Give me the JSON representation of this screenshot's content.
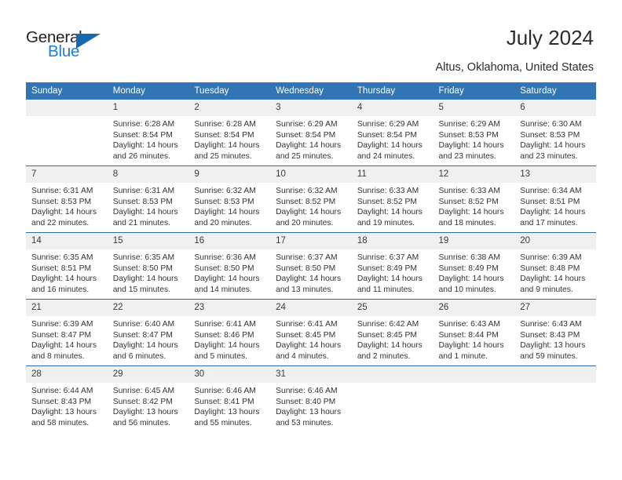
{
  "brand": {
    "name_top": "General",
    "name_bottom": "Blue",
    "colors": {
      "top_text": "#231f20",
      "bottom_text": "#1c7fd4",
      "triangle": "#1769b0"
    }
  },
  "header": {
    "title": "July 2024",
    "subtitle": "Altus, Oklahoma, United States"
  },
  "theme": {
    "header_bg": "#3275b5",
    "header_text": "#ffffff",
    "row_border": "#2e6da4",
    "daynum_bg": "#f0f0f0",
    "cell_bg": "#ffffff",
    "body_text": "#333333"
  },
  "calendar": {
    "weekdays": [
      "Sunday",
      "Monday",
      "Tuesday",
      "Wednesday",
      "Thursday",
      "Friday",
      "Saturday"
    ],
    "weeks": [
      [
        {
          "day": "",
          "sunrise": "",
          "sunset": "",
          "daylight1": "",
          "daylight2": ""
        },
        {
          "day": "1",
          "sunrise": "Sunrise: 6:28 AM",
          "sunset": "Sunset: 8:54 PM",
          "daylight1": "Daylight: 14 hours",
          "daylight2": "and 26 minutes."
        },
        {
          "day": "2",
          "sunrise": "Sunrise: 6:28 AM",
          "sunset": "Sunset: 8:54 PM",
          "daylight1": "Daylight: 14 hours",
          "daylight2": "and 25 minutes."
        },
        {
          "day": "3",
          "sunrise": "Sunrise: 6:29 AM",
          "sunset": "Sunset: 8:54 PM",
          "daylight1": "Daylight: 14 hours",
          "daylight2": "and 25 minutes."
        },
        {
          "day": "4",
          "sunrise": "Sunrise: 6:29 AM",
          "sunset": "Sunset: 8:54 PM",
          "daylight1": "Daylight: 14 hours",
          "daylight2": "and 24 minutes."
        },
        {
          "day": "5",
          "sunrise": "Sunrise: 6:29 AM",
          "sunset": "Sunset: 8:53 PM",
          "daylight1": "Daylight: 14 hours",
          "daylight2": "and 23 minutes."
        },
        {
          "day": "6",
          "sunrise": "Sunrise: 6:30 AM",
          "sunset": "Sunset: 8:53 PM",
          "daylight1": "Daylight: 14 hours",
          "daylight2": "and 23 minutes."
        }
      ],
      [
        {
          "day": "7",
          "sunrise": "Sunrise: 6:31 AM",
          "sunset": "Sunset: 8:53 PM",
          "daylight1": "Daylight: 14 hours",
          "daylight2": "and 22 minutes."
        },
        {
          "day": "8",
          "sunrise": "Sunrise: 6:31 AM",
          "sunset": "Sunset: 8:53 PM",
          "daylight1": "Daylight: 14 hours",
          "daylight2": "and 21 minutes."
        },
        {
          "day": "9",
          "sunrise": "Sunrise: 6:32 AM",
          "sunset": "Sunset: 8:53 PM",
          "daylight1": "Daylight: 14 hours",
          "daylight2": "and 20 minutes."
        },
        {
          "day": "10",
          "sunrise": "Sunrise: 6:32 AM",
          "sunset": "Sunset: 8:52 PM",
          "daylight1": "Daylight: 14 hours",
          "daylight2": "and 20 minutes."
        },
        {
          "day": "11",
          "sunrise": "Sunrise: 6:33 AM",
          "sunset": "Sunset: 8:52 PM",
          "daylight1": "Daylight: 14 hours",
          "daylight2": "and 19 minutes."
        },
        {
          "day": "12",
          "sunrise": "Sunrise: 6:33 AM",
          "sunset": "Sunset: 8:52 PM",
          "daylight1": "Daylight: 14 hours",
          "daylight2": "and 18 minutes."
        },
        {
          "day": "13",
          "sunrise": "Sunrise: 6:34 AM",
          "sunset": "Sunset: 8:51 PM",
          "daylight1": "Daylight: 14 hours",
          "daylight2": "and 17 minutes."
        }
      ],
      [
        {
          "day": "14",
          "sunrise": "Sunrise: 6:35 AM",
          "sunset": "Sunset: 8:51 PM",
          "daylight1": "Daylight: 14 hours",
          "daylight2": "and 16 minutes."
        },
        {
          "day": "15",
          "sunrise": "Sunrise: 6:35 AM",
          "sunset": "Sunset: 8:50 PM",
          "daylight1": "Daylight: 14 hours",
          "daylight2": "and 15 minutes."
        },
        {
          "day": "16",
          "sunrise": "Sunrise: 6:36 AM",
          "sunset": "Sunset: 8:50 PM",
          "daylight1": "Daylight: 14 hours",
          "daylight2": "and 14 minutes."
        },
        {
          "day": "17",
          "sunrise": "Sunrise: 6:37 AM",
          "sunset": "Sunset: 8:50 PM",
          "daylight1": "Daylight: 14 hours",
          "daylight2": "and 13 minutes."
        },
        {
          "day": "18",
          "sunrise": "Sunrise: 6:37 AM",
          "sunset": "Sunset: 8:49 PM",
          "daylight1": "Daylight: 14 hours",
          "daylight2": "and 11 minutes."
        },
        {
          "day": "19",
          "sunrise": "Sunrise: 6:38 AM",
          "sunset": "Sunset: 8:49 PM",
          "daylight1": "Daylight: 14 hours",
          "daylight2": "and 10 minutes."
        },
        {
          "day": "20",
          "sunrise": "Sunrise: 6:39 AM",
          "sunset": "Sunset: 8:48 PM",
          "daylight1": "Daylight: 14 hours",
          "daylight2": "and 9 minutes."
        }
      ],
      [
        {
          "day": "21",
          "sunrise": "Sunrise: 6:39 AM",
          "sunset": "Sunset: 8:47 PM",
          "daylight1": "Daylight: 14 hours",
          "daylight2": "and 8 minutes."
        },
        {
          "day": "22",
          "sunrise": "Sunrise: 6:40 AM",
          "sunset": "Sunset: 8:47 PM",
          "daylight1": "Daylight: 14 hours",
          "daylight2": "and 6 minutes."
        },
        {
          "day": "23",
          "sunrise": "Sunrise: 6:41 AM",
          "sunset": "Sunset: 8:46 PM",
          "daylight1": "Daylight: 14 hours",
          "daylight2": "and 5 minutes."
        },
        {
          "day": "24",
          "sunrise": "Sunrise: 6:41 AM",
          "sunset": "Sunset: 8:45 PM",
          "daylight1": "Daylight: 14 hours",
          "daylight2": "and 4 minutes."
        },
        {
          "day": "25",
          "sunrise": "Sunrise: 6:42 AM",
          "sunset": "Sunset: 8:45 PM",
          "daylight1": "Daylight: 14 hours",
          "daylight2": "and 2 minutes."
        },
        {
          "day": "26",
          "sunrise": "Sunrise: 6:43 AM",
          "sunset": "Sunset: 8:44 PM",
          "daylight1": "Daylight: 14 hours",
          "daylight2": "and 1 minute."
        },
        {
          "day": "27",
          "sunrise": "Sunrise: 6:43 AM",
          "sunset": "Sunset: 8:43 PM",
          "daylight1": "Daylight: 13 hours",
          "daylight2": "and 59 minutes."
        }
      ],
      [
        {
          "day": "28",
          "sunrise": "Sunrise: 6:44 AM",
          "sunset": "Sunset: 8:43 PM",
          "daylight1": "Daylight: 13 hours",
          "daylight2": "and 58 minutes."
        },
        {
          "day": "29",
          "sunrise": "Sunrise: 6:45 AM",
          "sunset": "Sunset: 8:42 PM",
          "daylight1": "Daylight: 13 hours",
          "daylight2": "and 56 minutes."
        },
        {
          "day": "30",
          "sunrise": "Sunrise: 6:46 AM",
          "sunset": "Sunset: 8:41 PM",
          "daylight1": "Daylight: 13 hours",
          "daylight2": "and 55 minutes."
        },
        {
          "day": "31",
          "sunrise": "Sunrise: 6:46 AM",
          "sunset": "Sunset: 8:40 PM",
          "daylight1": "Daylight: 13 hours",
          "daylight2": "and 53 minutes."
        },
        {
          "day": "",
          "sunrise": "",
          "sunset": "",
          "daylight1": "",
          "daylight2": ""
        },
        {
          "day": "",
          "sunrise": "",
          "sunset": "",
          "daylight1": "",
          "daylight2": ""
        },
        {
          "day": "",
          "sunrise": "",
          "sunset": "",
          "daylight1": "",
          "daylight2": ""
        }
      ]
    ]
  }
}
